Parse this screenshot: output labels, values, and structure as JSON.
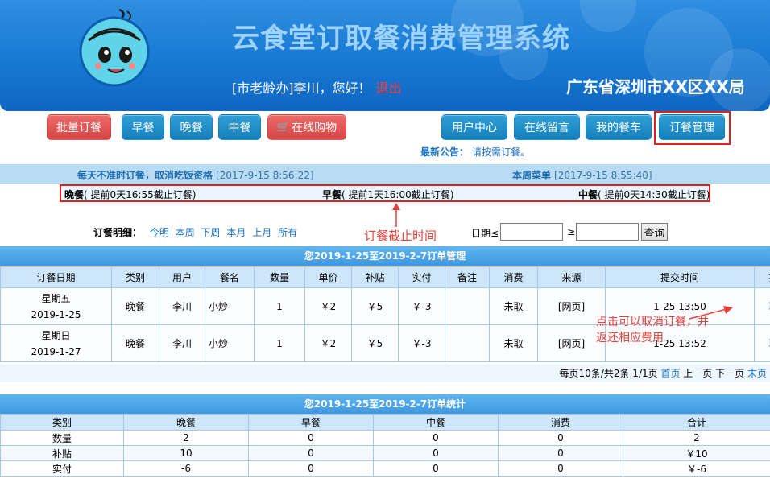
{
  "header": {
    "title": "云食堂订取餐消费管理系统",
    "user_prefix": "[市老龄办]李川，您好！",
    "logout": "退出",
    "org": "广东省深圳市XX区XX局"
  },
  "nav": {
    "batch_order": "批量订餐",
    "breakfast": "早餐",
    "dinner": "晚餐",
    "lunch": "中餐",
    "online_shop": "在线购物",
    "user_center": "用户中心",
    "message": "在线留言",
    "my_cart": "我的餐车",
    "order_mgmt": "订餐管理"
  },
  "notice": {
    "label": "最新公告：",
    "text": "请按需订餐。"
  },
  "infobar": {
    "left_label": "每天不准时订餐，取消吃饭资格",
    "left_time": "[2017-9-15 8:56:22]",
    "right_label": "本周菜单",
    "right_time": "[2017-9-15 8:55:40]"
  },
  "meals": {
    "dinner_label": "晚餐",
    "dinner_text": "( 提前0天16:55截止订餐)",
    "breakfast_label": "早餐",
    "breakfast_text": "( 提前1天16:00截止订餐)",
    "lunch_label": "中餐",
    "lunch_text": "( 提前0天14:30截止订餐)"
  },
  "annotations": {
    "deadline": "订餐截止时间",
    "cancel": "点击可以取消订餐，并返还相应费用"
  },
  "filter": {
    "label": "订餐明细：",
    "links": [
      "今明",
      "本周",
      "下周",
      "本月",
      "上月",
      "所有"
    ],
    "date_label": "日期≤",
    "ge_label": "≥",
    "query": "查询"
  },
  "orders": {
    "caption": "您2019-1-25至2019-2-7订单管理",
    "headers": [
      "订餐日期",
      "类别",
      "用户",
      "餐名",
      "数量",
      "单价",
      "补贴",
      "实付",
      "备注",
      "消费",
      "来源",
      "提交时间",
      "操作"
    ],
    "rows": [
      [
        "星期五",
        "2019-1-25",
        "晚餐",
        "李川",
        "小炒",
        "1",
        "￥2",
        "￥5",
        "￥-3",
        "",
        "未取",
        "[网页]",
        "1-25 13:50",
        "取消"
      ],
      [
        "星期日",
        "2019-1-27",
        "晚餐",
        "李川",
        "小炒",
        "1",
        "￥2",
        "￥5",
        "￥-3",
        "",
        "未取",
        "[网页]",
        "1-25 13:52",
        "取消"
      ]
    ]
  },
  "pager": {
    "info": "每页10条/共2条 1/1页",
    "first": "首页",
    "prev": "上一页",
    "next": "下一页",
    "last": "末页"
  },
  "stats": {
    "caption": "您2019-1-25至2019-2-7订单统计",
    "headers": [
      "类别",
      "晚餐",
      "早餐",
      "中餐",
      "消费",
      "合计"
    ],
    "rows": [
      [
        "数量",
        "2",
        "0",
        "0",
        "0",
        "2"
      ],
      [
        "补贴",
        "10",
        "0",
        "0",
        "0",
        "￥10"
      ],
      [
        "实付",
        "-6",
        "0",
        "0",
        "0",
        "￥-6"
      ]
    ]
  },
  "colors": {
    "banner": "#1677d2",
    "accent_red": "#e02020",
    "link": "#1a6fbf"
  }
}
